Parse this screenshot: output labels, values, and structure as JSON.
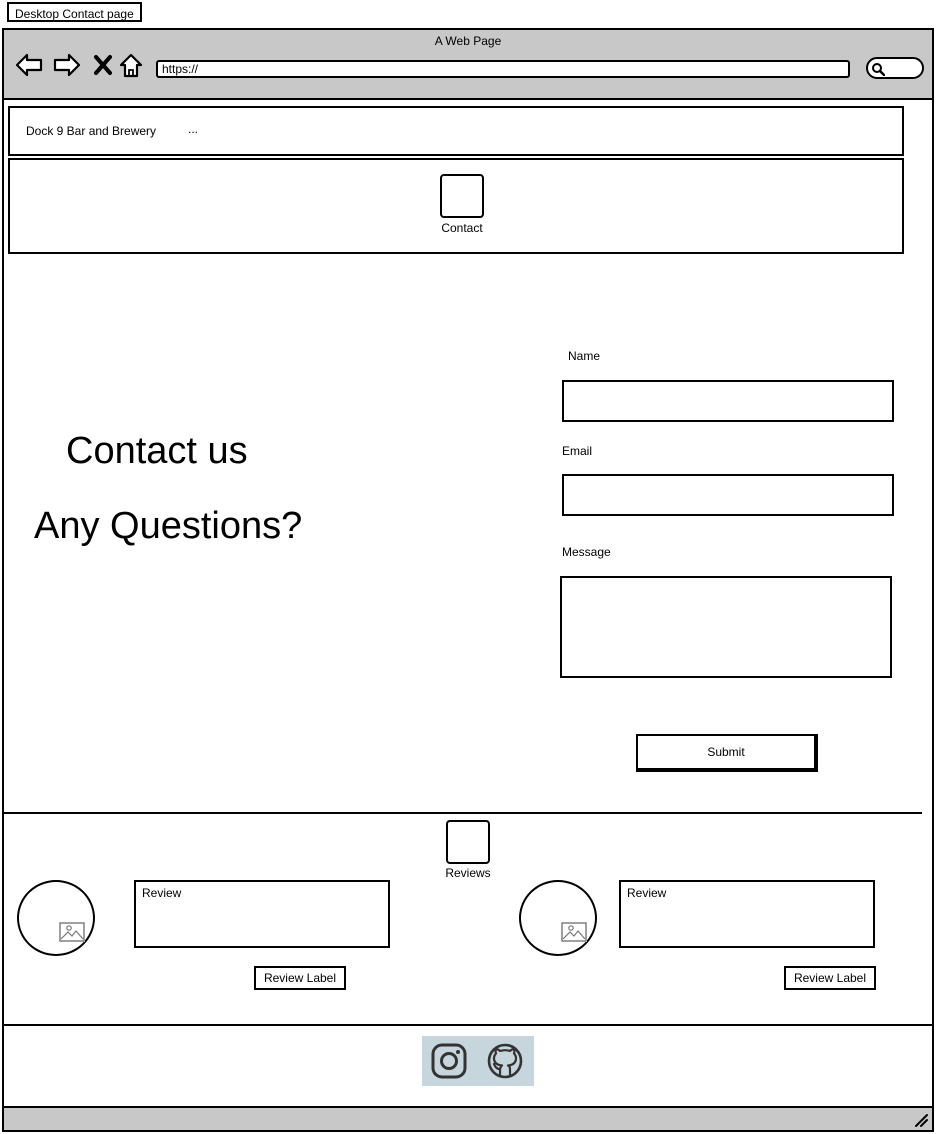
{
  "page_tag": "Desktop Contact page",
  "browser": {
    "title": "A Web Page",
    "url": "https://"
  },
  "site": {
    "brand": "Dock 9 Bar and Brewery",
    "more": "..."
  },
  "hero": {
    "label": "Contact"
  },
  "contact": {
    "heading": "Contact us",
    "subheading": "Any Questions?"
  },
  "form": {
    "name_label": "Name",
    "name_value": "",
    "email_label": "Email",
    "email_value": "",
    "message_label": "Message",
    "message_value": "",
    "submit_label": "Submit"
  },
  "reviews": {
    "heading": "Reviews",
    "items": [
      {
        "text": "Review",
        "label": "Review Label"
      },
      {
        "text": "Review",
        "label": "Review Label"
      }
    ]
  },
  "social": {
    "icons": [
      "instagram-icon",
      "github-icon"
    ],
    "bar_color": "#c6d6dc"
  },
  "colors": {
    "chrome": "#c8c8c8",
    "border": "#000000"
  }
}
